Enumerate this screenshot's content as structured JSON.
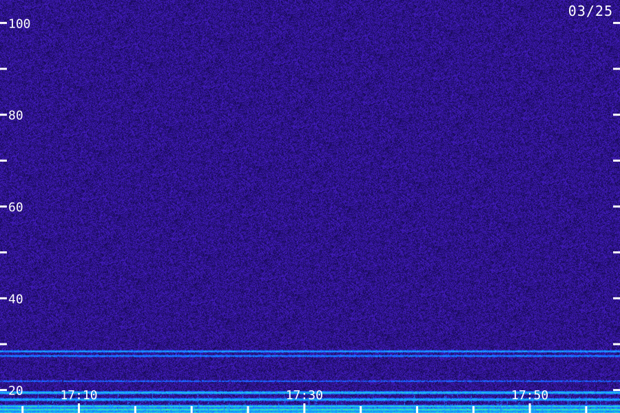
{
  "date_label": "03/25",
  "colors": {
    "background": "#1a0a5e",
    "noise_low": "#120848",
    "noise_high": "#4a1fd0",
    "band_low": "#1a4cff",
    "band_mid": "#19b8ff",
    "band_high": "#40ff80",
    "axis": "#ffffff"
  },
  "chart_data": {
    "type": "heatmap",
    "title": "",
    "xlabel": "",
    "ylabel": "",
    "ylim": [
      15,
      105
    ],
    "xlim_minutes": [
      "17:03",
      "17:58"
    ],
    "y_ticks_major": [
      100,
      80,
      60,
      40,
      20
    ],
    "y_ticks_minor": [
      90,
      70,
      50,
      30
    ],
    "x_tick_labels": [
      "17:10",
      "17:30",
      "17:50"
    ],
    "x_tick_values": [
      "17:10",
      "17:30",
      "17:50"
    ],
    "x_minor_ticks": [
      "17:05",
      "17:15",
      "17:20",
      "17:25",
      "17:35",
      "17:40",
      "17:45",
      "17:55"
    ],
    "bands": [
      {
        "y": 28.5,
        "intensity": 0.55
      },
      {
        "y": 27.5,
        "intensity": 0.45
      },
      {
        "y": 22.0,
        "intensity": 0.35
      },
      {
        "y": 19.5,
        "intensity": 0.65
      },
      {
        "y": 18.0,
        "intensity": 0.55
      },
      {
        "y": 16.5,
        "intensity": 0.75
      },
      {
        "y": 15.8,
        "intensity": 0.95
      },
      {
        "y": 15.2,
        "intensity": 0.7
      }
    ]
  }
}
